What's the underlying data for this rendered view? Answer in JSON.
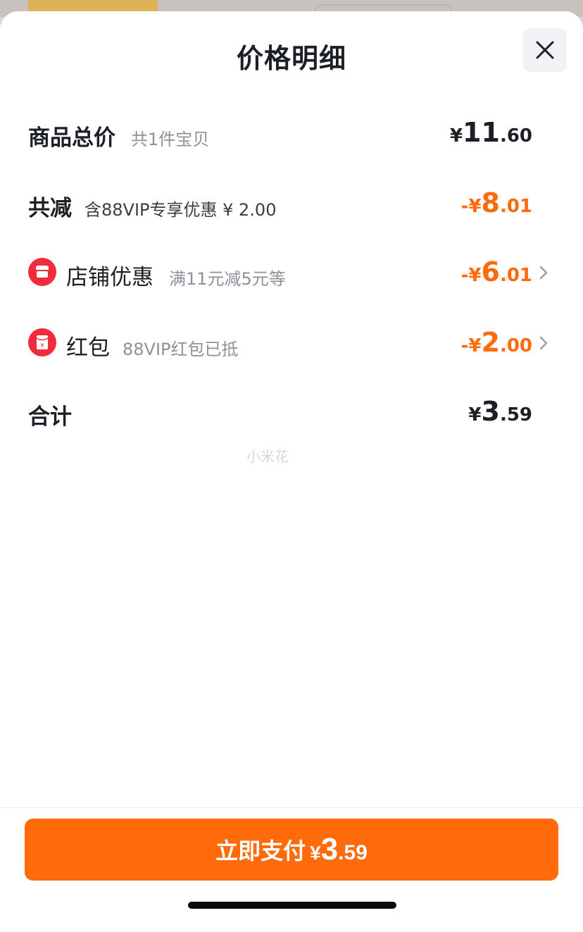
{
  "sheet": {
    "title": "价格明细",
    "close_icon": "close-icon"
  },
  "rows": {
    "total_goods": {
      "label": "商品总价",
      "note": "共1件宝贝",
      "amount": {
        "sign": "¥",
        "int": "11",
        "dec": ".60"
      }
    },
    "total_reduction": {
      "label": "共减",
      "note": "含88VIP专享优惠 ¥ 2.00",
      "amount": {
        "sign": "-¥",
        "int": "8",
        "dec": ".01"
      }
    },
    "store_discount": {
      "icon": "store-icon",
      "label": "店铺优惠",
      "note": "满11元减5元等",
      "amount": {
        "sign": "-¥",
        "int": "6",
        "dec": ".01"
      }
    },
    "red_packet": {
      "icon": "red-packet-icon",
      "label": "红包",
      "note": "88VIP红包已抵",
      "amount": {
        "sign": "-¥",
        "int": "2",
        "dec": ".00"
      }
    },
    "subtotal": {
      "label": "合计",
      "amount": {
        "sign": "¥",
        "int": "3",
        "dec": ".59"
      }
    }
  },
  "watermark": "小米花",
  "pay_button": {
    "label": "立即支付",
    "amount": {
      "sign": "¥",
      "int": "3",
      "dec": ".59"
    }
  },
  "colors": {
    "accent": "#ff6a0a",
    "icon_red": "#f02b3c",
    "text_primary": "#1c1f26",
    "text_secondary": "#8d919a"
  }
}
